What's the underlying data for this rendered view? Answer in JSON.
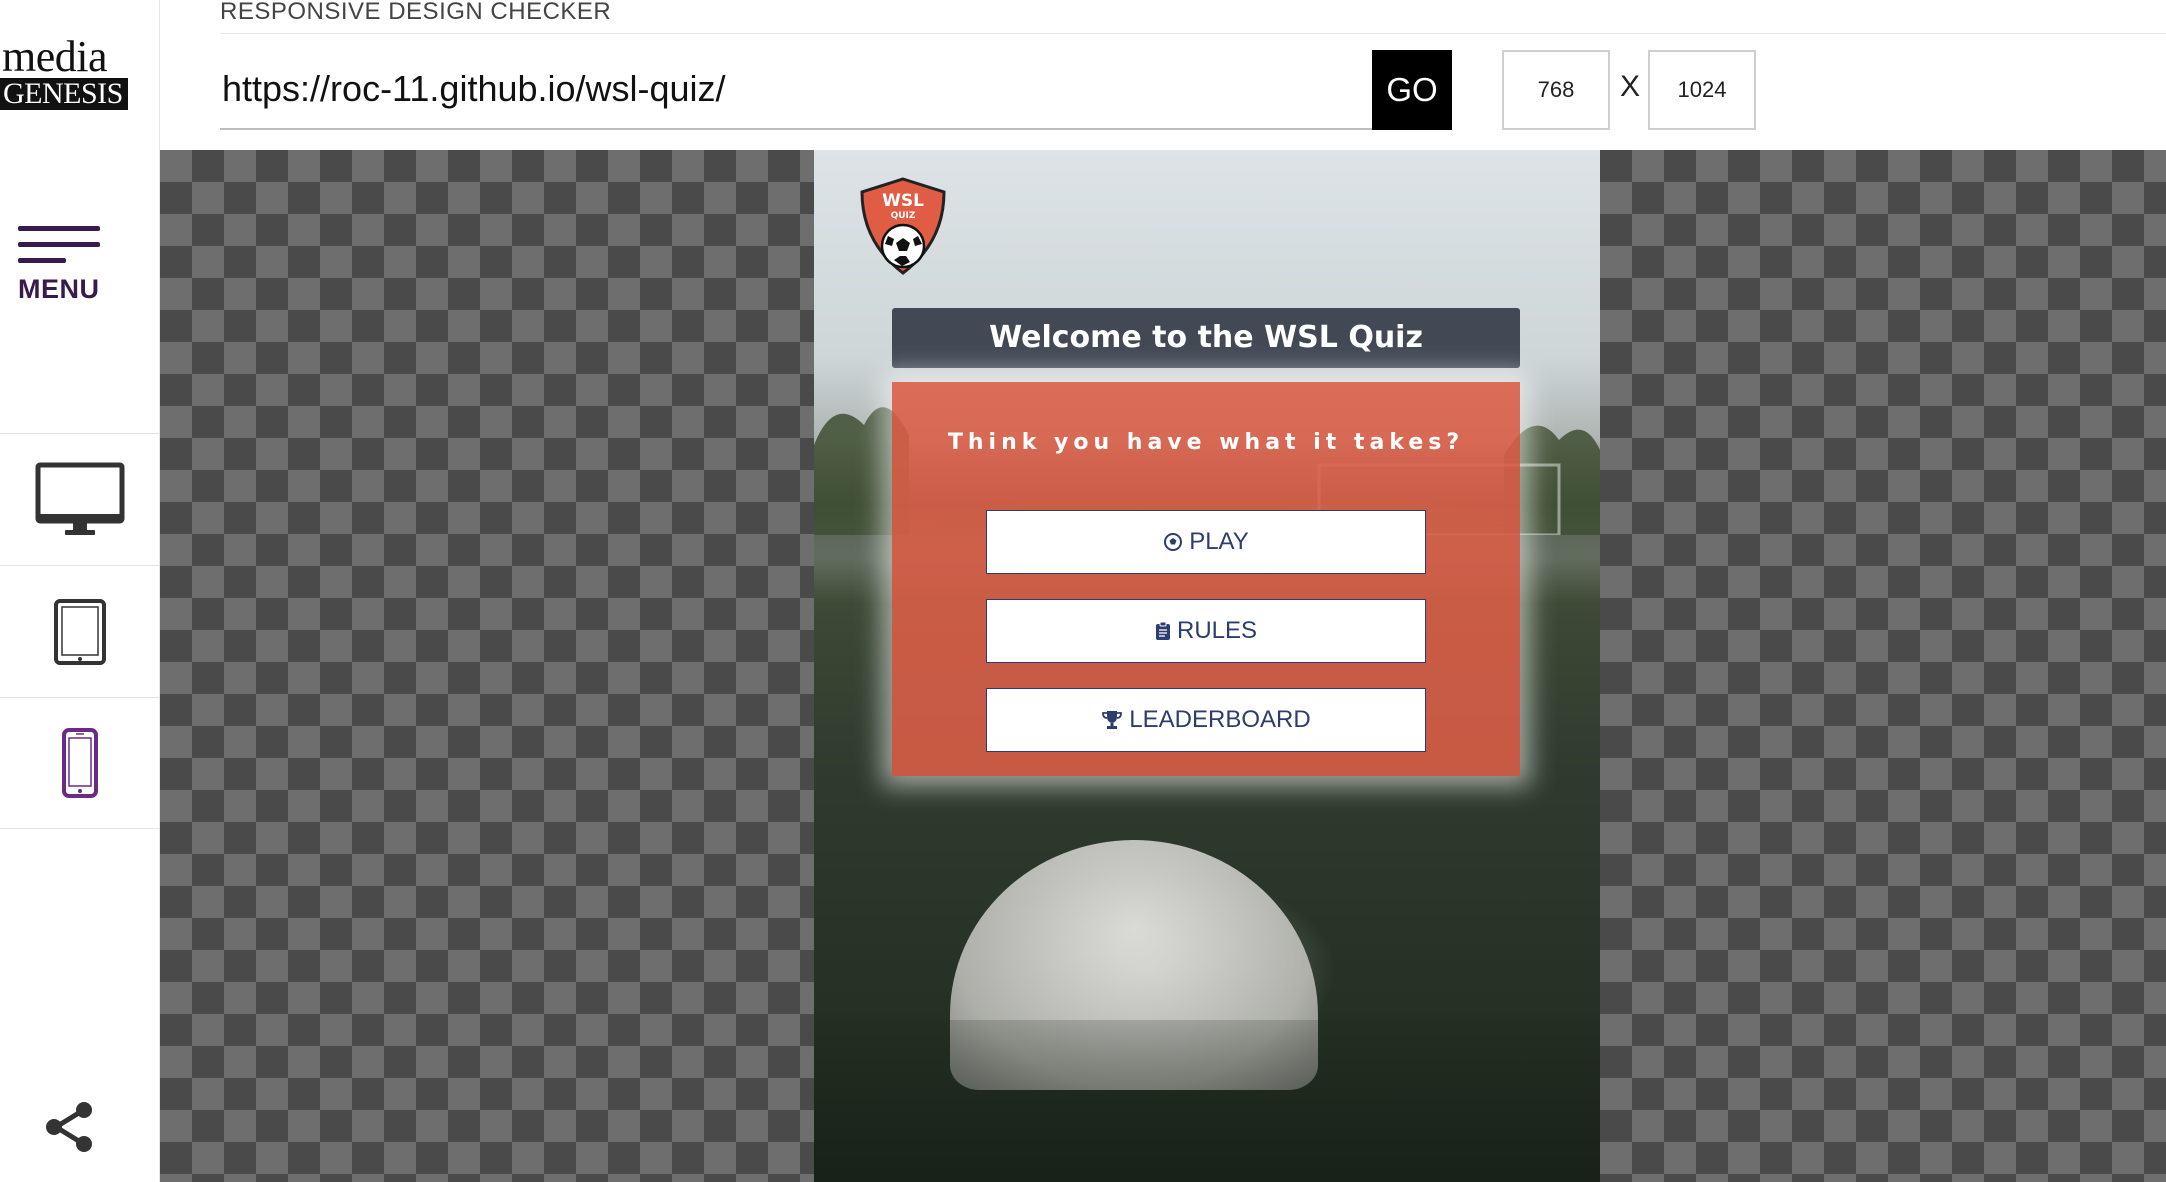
{
  "app": {
    "title": "RESPONSIVE DESIGN CHECKER",
    "logo_top": "media",
    "logo_bottom": "GENESIS"
  },
  "sidebar": {
    "menu_label": "MENU",
    "devices": [
      {
        "name": "desktop",
        "icon": "monitor-icon"
      },
      {
        "name": "tablet",
        "icon": "tablet-icon"
      },
      {
        "name": "mobile",
        "icon": "phone-icon",
        "active": true
      }
    ],
    "share_icon": "share-icon"
  },
  "toolbar": {
    "url_value": "https://roc-11.github.io/wsl-quiz/",
    "go_label": "GO",
    "width_value": "768",
    "times_label": "X",
    "height_value": "1024"
  },
  "site": {
    "logo_text_top": "WSL",
    "logo_text_bottom": "QUIZ",
    "welcome": "Welcome to the WSL Quiz",
    "tagline": "Think you have what it takes?",
    "buttons": {
      "play": "PLAY",
      "rules": "RULES",
      "leaderboard": "LEADERBOARD"
    }
  },
  "colors": {
    "accent_purple": "#3a1a4a",
    "card_red": "#dd5e48",
    "welcome_bar": "#424854",
    "button_text": "#2d3e6e"
  }
}
